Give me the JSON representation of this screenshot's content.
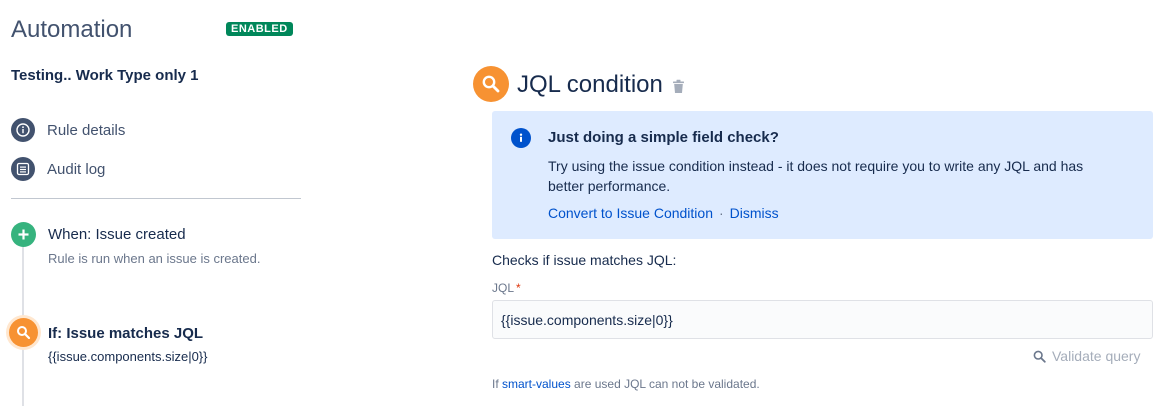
{
  "sidebar": {
    "title": "Automation",
    "status_badge": "ENABLED",
    "rule_name": "Testing.. Work Type only 1",
    "nav": [
      {
        "label": "Rule details",
        "icon": "info-icon"
      },
      {
        "label": "Audit log",
        "icon": "list-icon"
      }
    ],
    "components": [
      {
        "type": "trigger",
        "icon": "plus-icon",
        "title": "When: Issue created",
        "description": "Rule is run when an issue is created."
      },
      {
        "type": "condition",
        "icon": "search-icon",
        "title": "If: Issue matches JQL",
        "description": "{{issue.components.size|0}}"
      }
    ]
  },
  "main": {
    "title": "JQL condition",
    "header_icon": "search-icon",
    "delete_icon": "trash-icon",
    "info": {
      "title": "Just doing a simple field check?",
      "body": "Try using the issue condition instead - it does not require you to write any JQL and has better performance.",
      "convert_link": "Convert to Issue Condition",
      "separator": "·",
      "dismiss_link": "Dismiss"
    },
    "checks_text": "Checks if issue matches JQL:",
    "jql_label": "JQL",
    "required_mark": "*",
    "jql_value": "{{issue.components.size|0}}",
    "validate_label": "Validate query",
    "footnote_prefix": "If ",
    "footnote_link": "smart-values",
    "footnote_suffix": " are used JQL can not be validated."
  },
  "colors": {
    "enabled_green": "#00875a",
    "condition_orange": "#f79232",
    "trigger_green": "#36b37e",
    "info_bg": "#deebff",
    "link_blue": "#0052cc"
  }
}
